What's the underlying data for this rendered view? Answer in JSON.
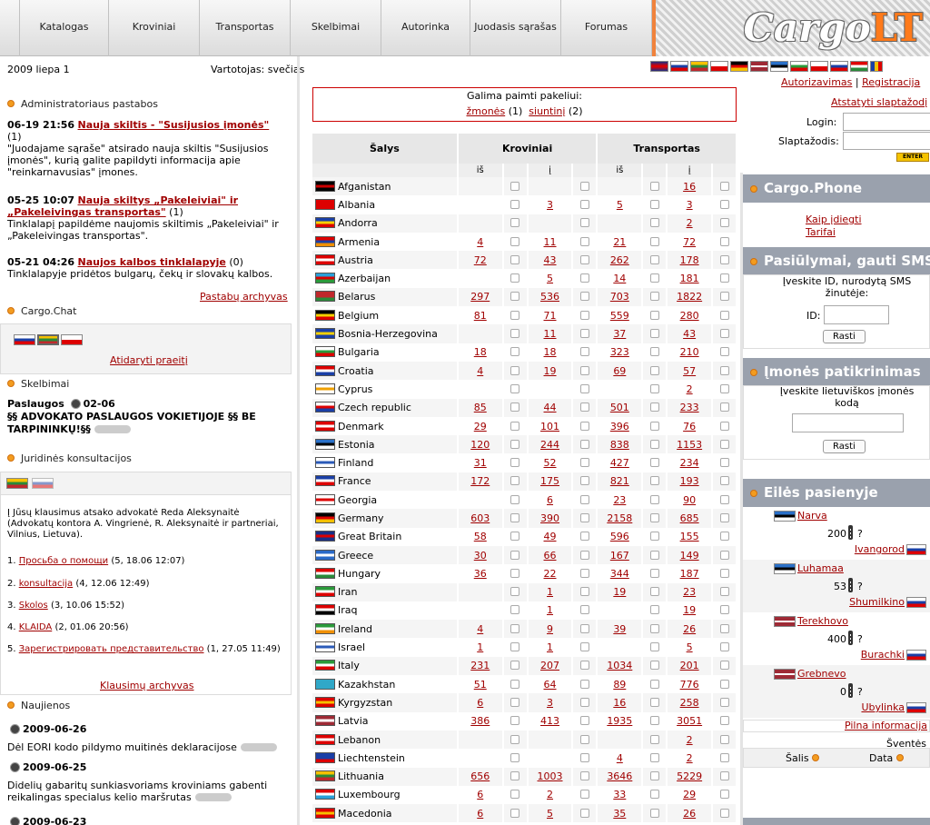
{
  "nav": {
    "items": [
      "Katalogas",
      "Kroviniai",
      "Transportas",
      "Skelbimai",
      "Autorinka",
      "Juodasis sąrašas",
      "Forumas"
    ],
    "logo": "Cargo",
    "logo_accent": "LT"
  },
  "topbar": {
    "date": "2009 liepa 1",
    "user": "Vartotojas: svečias",
    "login_link": "Autorizavimas",
    "sep": "|",
    "register_link": "Registracija",
    "reset_link": "Atstatyti slaptažodį",
    "login_label": "Login:",
    "password_label": "Slaptažodis:",
    "enter_label": "ENTER"
  },
  "notices": {
    "title": "Administratoriaus pastabos",
    "items": [
      {
        "head": "06-19 21:56",
        "link": "Nauja skiltis - \"Susijusios įmonės\"",
        "count": "(1)",
        "body": "\"Juodajame sąraše\" atsirado nauja skiltis \"Susijusios įmonės\", kurią galite papildyti informacija apie \"reinkarnavusias\" įmones."
      },
      {
        "head": "05-25 10:07",
        "link": "Nauja skiltys „Pakeleiviai\" ir „Pakeleivingas transportas\"",
        "count": "(1)",
        "body": "Tinklalapį papildėme naujomis skiltimis „Pakeleiviai\" ir „Pakeleivingas transportas\"."
      },
      {
        "head": "05-21 04:26",
        "link": "Naujos kalbos tinklalapyje",
        "count": "(0)",
        "body": "Tinklalapyje pridėtos bulgarų, čekų ir slovakų kalbos."
      }
    ],
    "archive": "Pastabų archyvas"
  },
  "chat": {
    "title": "Cargo.Chat",
    "open_prev": "Atidaryti praeitį"
  },
  "ads": {
    "title": "Skelbimai",
    "cat": "Paslaugos",
    "date": "02-06",
    "text": "§§ ADVOKATO PASLAUGOS VOKIETIJOJE §§ BE TARPININKŲ!§§"
  },
  "legal": {
    "title": "Juridinės konsultacijos",
    "intro": "Į Jūsų klausimus atsako advokatė Reda Aleksynaitė (Advokatų kontora A. Vingrienė, R. Aleksynaitė ir partneriai, Vilnius, Lietuva).",
    "items": [
      {
        "num": "1.",
        "link": "Просьба о помощи",
        "meta": "(5, 18.06 12:07)"
      },
      {
        "num": "2.",
        "link": "konsultacija",
        "meta": "(4, 12.06 12:49)"
      },
      {
        "num": "3.",
        "link": "Skolos",
        "meta": "(3, 10.06 15:52)"
      },
      {
        "num": "4.",
        "link": "KLAIDA",
        "meta": "(2, 01.06 20:56)"
      },
      {
        "num": "5.",
        "link": "Зарегистрировать представительство",
        "meta": "(1, 27.05 11:49)"
      }
    ],
    "archive": "Klausimų archyvas"
  },
  "news": {
    "title": "Naujienos",
    "items": [
      {
        "date": "2009-06-26",
        "text": "Dėl EORI kodo pildymo muitinės deklaracijose"
      },
      {
        "date": "2009-06-25",
        "text": "Didelių gabaritų sunkiasvoriams kroviniams gabenti reikalingas specialus kelio maršrutas"
      },
      {
        "date": "2009-06-23",
        "text": ""
      }
    ]
  },
  "pickup": {
    "title": "Galima paimti pakeliui:",
    "people": "žmonės",
    "people_count": "(1)",
    "parcels": "siuntinį",
    "parcels_count": "(2)"
  },
  "table": {
    "h_country": "Šalys",
    "h_cargo": "Kroviniai",
    "h_transport": "Transportas",
    "from": "iš",
    "to": "į",
    "rows": [
      {
        "c": "Afganistan",
        "a": "",
        "b": "",
        "d": "",
        "e": "16",
        "f": [
          "#000",
          "#c00",
          "#000"
        ]
      },
      {
        "c": "Albania",
        "a": "",
        "b": "3",
        "d": "5",
        "e": "3",
        "f": [
          "#d00",
          "#d00",
          "#d00"
        ]
      },
      {
        "c": "Andorra",
        "a": "",
        "b": "",
        "d": "",
        "e": "2",
        "f": [
          "#1a3fa6",
          "#f5d000",
          "#d00"
        ]
      },
      {
        "c": "Armenia",
        "a": "4",
        "b": "11",
        "d": "21",
        "e": "72",
        "f": [
          "#d00",
          "#1a3fa6",
          "#f09000"
        ]
      },
      {
        "c": "Austria",
        "a": "72",
        "b": "43",
        "d": "262",
        "e": "178",
        "f": [
          "#d00",
          "#fff",
          "#d00"
        ]
      },
      {
        "c": "Azerbaijan",
        "a": "",
        "b": "5",
        "d": "14",
        "e": "181",
        "f": [
          "#2aa0d8",
          "#d00",
          "#2a9a3a"
        ]
      },
      {
        "c": "Belarus",
        "a": "297",
        "b": "536",
        "d": "703",
        "e": "1822",
        "f": [
          "#c0282c",
          "#c0282c",
          "#2a8a3a"
        ]
      },
      {
        "c": "Belgium",
        "a": "81",
        "b": "71",
        "d": "559",
        "e": "280",
        "f": [
          "#000",
          "#f5d000",
          "#d00"
        ]
      },
      {
        "c": "Bosnia-Herzegovina",
        "a": "",
        "b": "11",
        "d": "37",
        "e": "43",
        "f": [
          "#1a3fa6",
          "#f5d000",
          "#1a3fa6"
        ]
      },
      {
        "c": "Bulgaria",
        "a": "18",
        "b": "18",
        "d": "323",
        "e": "210",
        "f": [
          "#fff",
          "#2a9a3a",
          "#d00"
        ]
      },
      {
        "c": "Croatia",
        "a": "4",
        "b": "19",
        "d": "69",
        "e": "57",
        "f": [
          "#d00",
          "#fff",
          "#1a3fa6"
        ]
      },
      {
        "c": "Cyprus",
        "a": "",
        "b": "",
        "d": "",
        "e": "2",
        "f": [
          "#fff",
          "#f0a000",
          "#fff"
        ]
      },
      {
        "c": "Czech republic",
        "a": "85",
        "b": "44",
        "d": "501",
        "e": "233",
        "f": [
          "#fff",
          "#d00",
          "#1a3fa6"
        ]
      },
      {
        "c": "Denmark",
        "a": "29",
        "b": "101",
        "d": "396",
        "e": "76",
        "f": [
          "#d00",
          "#fff",
          "#d00"
        ]
      },
      {
        "c": "Estonia",
        "a": "120",
        "b": "244",
        "d": "838",
        "e": "1153",
        "f": [
          "#2a70c8",
          "#000",
          "#fff"
        ]
      },
      {
        "c": "Finland",
        "a": "31",
        "b": "52",
        "d": "427",
        "e": "234",
        "f": [
          "#fff",
          "#2a5ab8",
          "#fff"
        ]
      },
      {
        "c": "France",
        "a": "172",
        "b": "175",
        "d": "821",
        "e": "193",
        "f": [
          "#1a3fa6",
          "#fff",
          "#d00"
        ]
      },
      {
        "c": "Georgia",
        "a": "",
        "b": "6",
        "d": "23",
        "e": "90",
        "f": [
          "#fff",
          "#d00",
          "#fff"
        ]
      },
      {
        "c": "Germany",
        "a": "603",
        "b": "390",
        "d": "2158",
        "e": "685",
        "f": [
          "#000",
          "#d00",
          "#f5c000"
        ]
      },
      {
        "c": "Great Britain",
        "a": "58",
        "b": "49",
        "d": "596",
        "e": "155",
        "f": [
          "#1a2f86",
          "#d00",
          "#1a2f86"
        ]
      },
      {
        "c": "Greece",
        "a": "30",
        "b": "66",
        "d": "167",
        "e": "149",
        "f": [
          "#2a6ac8",
          "#fff",
          "#2a6ac8"
        ]
      },
      {
        "c": "Hungary",
        "a": "36",
        "b": "22",
        "d": "344",
        "e": "187",
        "f": [
          "#d00",
          "#fff",
          "#2a8a3a"
        ]
      },
      {
        "c": "Iran",
        "a": "",
        "b": "1",
        "d": "19",
        "e": "23",
        "f": [
          "#2a9a3a",
          "#fff",
          "#d00"
        ]
      },
      {
        "c": "Iraq",
        "a": "",
        "b": "1",
        "d": "",
        "e": "19",
        "f": [
          "#d00",
          "#fff",
          "#000"
        ]
      },
      {
        "c": "Ireland",
        "a": "4",
        "b": "9",
        "d": "39",
        "e": "26",
        "f": [
          "#2a9a3a",
          "#fff",
          "#f09000"
        ]
      },
      {
        "c": "Israel",
        "a": "1",
        "b": "1",
        "d": "",
        "e": "5",
        "f": [
          "#fff",
          "#2a5ab8",
          "#fff"
        ]
      },
      {
        "c": "Italy",
        "a": "231",
        "b": "207",
        "d": "1034",
        "e": "201",
        "f": [
          "#2a9a3a",
          "#fff",
          "#d00"
        ]
      },
      {
        "c": "Kazakhstan",
        "a": "51",
        "b": "64",
        "d": "89",
        "e": "776",
        "f": [
          "#30a8c8",
          "#30a8c8",
          "#30a8c8"
        ]
      },
      {
        "c": "Kyrgyzstan",
        "a": "6",
        "b": "3",
        "d": "16",
        "e": "258",
        "f": [
          "#d00",
          "#f5c000",
          "#d00"
        ]
      },
      {
        "c": "Latvia",
        "a": "386",
        "b": "413",
        "d": "1935",
        "e": "3051",
        "f": [
          "#9e2a35",
          "#fff",
          "#9e2a35"
        ]
      },
      {
        "c": "Lebanon",
        "a": "",
        "b": "",
        "d": "",
        "e": "2",
        "f": [
          "#d00",
          "#fff",
          "#d00"
        ]
      },
      {
        "c": "Liechtenstein",
        "a": "",
        "b": "",
        "d": "4",
        "e": "2",
        "f": [
          "#1a3fa6",
          "#1a3fa6",
          "#d00"
        ]
      },
      {
        "c": "Lithuania",
        "a": "656",
        "b": "1003",
        "d": "3646",
        "e": "5229",
        "f": [
          "#f5c000",
          "#2a8a3a",
          "#c0282c"
        ]
      },
      {
        "c": "Luxembourg",
        "a": "6",
        "b": "2",
        "d": "33",
        "e": "29",
        "f": [
          "#d00",
          "#fff",
          "#2aa0d8"
        ]
      },
      {
        "c": "Macedonia",
        "a": "6",
        "b": "5",
        "d": "35",
        "e": "26",
        "f": [
          "#d00",
          "#f5c000",
          "#d00"
        ]
      }
    ]
  },
  "phone": {
    "title": "Cargo.Phone",
    "how": "Kaip įdiegti",
    "tariffs": "Tarifai"
  },
  "sms": {
    "title": "Pasiūlymai, gauti SMS",
    "prompt": "Įveskite ID, nurodytą SMS žinutėje:",
    "id_label": "ID:",
    "btn": "Rasti"
  },
  "company": {
    "title": "Įmonės patikrinimas",
    "prompt": "Įveskite lietuviškos įmonės kodą",
    "btn": "Rasti"
  },
  "queue": {
    "title": "Eilės pasienyje",
    "items": [
      {
        "from": "Narva",
        "count": "200",
        "q": "?",
        "to": "Ivangorod"
      },
      {
        "from": "Luhamaa",
        "count": "53",
        "q": "?",
        "to": "Shumilkino"
      },
      {
        "from": "Terekhovo",
        "count": "400",
        "q": "?",
        "to": "Burachki"
      },
      {
        "from": "Grebnevo",
        "count": "0",
        "q": "?",
        "to": "Ubylinka"
      }
    ],
    "more": "Pilna informacija"
  },
  "holidays": {
    "title": "Šventės",
    "country": "Šalis",
    "date": "Data"
  }
}
